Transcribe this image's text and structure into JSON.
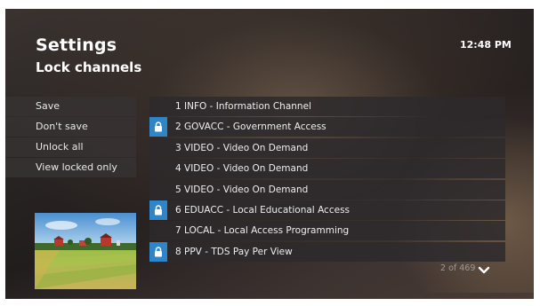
{
  "header": {
    "title": "Settings",
    "subtitle": "Lock channels",
    "time": "12:48 PM"
  },
  "menu": {
    "items": [
      {
        "label": "Save"
      },
      {
        "label": "Don't save"
      },
      {
        "label": "Unlock all"
      },
      {
        "label": "View locked only"
      }
    ]
  },
  "channels": [
    {
      "label": "1 INFO - Information Channel",
      "locked": false
    },
    {
      "label": "2 GOVACC - Government Access",
      "locked": true
    },
    {
      "label": "3 VIDEO - Video On Demand",
      "locked": false
    },
    {
      "label": "4 VIDEO - Video On Demand",
      "locked": false
    },
    {
      "label": "5 VIDEO - Video On Demand",
      "locked": false
    },
    {
      "label": "6 EDUACC - Local Educational Access",
      "locked": true
    },
    {
      "label": "7 LOCAL - Local Access Programming",
      "locked": false
    },
    {
      "label": "8 PPV - TDS Pay Per View",
      "locked": true
    }
  ],
  "pagination": {
    "counter": "2 of 469"
  },
  "icons": {
    "lock": "lock-icon",
    "scroll_down": "chevron-down-icon",
    "preview": "farm-landscape-thumbnail"
  },
  "colors": {
    "lock_highlight": "#2e86c8",
    "background": "#2a2524"
  }
}
